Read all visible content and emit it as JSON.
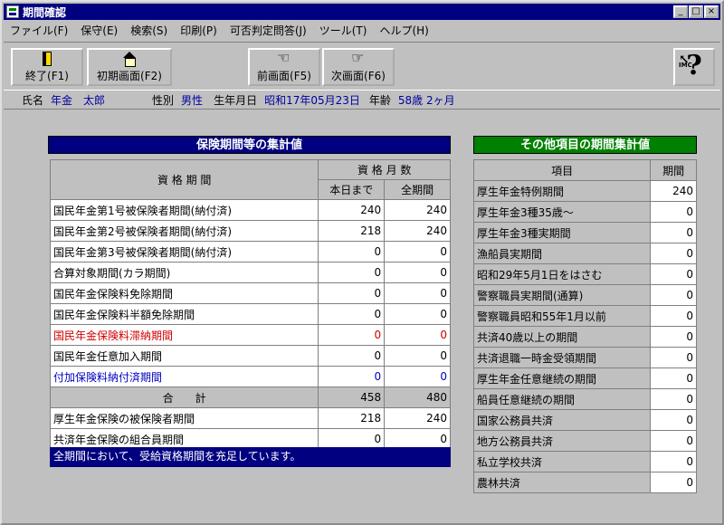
{
  "window": {
    "title": "期間確認",
    "btn_min": "_",
    "btn_max": "□",
    "btn_close": "×"
  },
  "menu": [
    "ファイル(F)",
    "保守(E)",
    "検索(S)",
    "印刷(P)",
    "可否判定問答(J)",
    "ツール(T)",
    "ヘルプ(H)"
  ],
  "toolbar": {
    "exit_label": "終了(F1)",
    "home_label": "初期画面(F2)",
    "prev_label": "前画面(F5)",
    "next_label": "次画面(F6)",
    "help_glyph": "?",
    "help_arrow": "↖",
    "help_caption": "IMC"
  },
  "person": {
    "name_label": "氏名",
    "name_value": "年金　太郎",
    "sex_label": "性別",
    "sex_value": "男性",
    "birth_label": "生年月日",
    "birth_value": "昭和17年05月23日",
    "age_label": "年齢",
    "age_value": "58歳 2ヶ月"
  },
  "left_panel": {
    "title": "保険期間等の集計値",
    "header_period": "資 格 期 間",
    "header_months": "資 格 月 数",
    "header_today": "本日まで",
    "header_all": "全期間",
    "rows": [
      {
        "label": "国民年金第1号被保険者期間(納付済)",
        "today": "240",
        "all": "240",
        "color": "normal"
      },
      {
        "label": "国民年金第2号被保険者期間(納付済)",
        "today": "218",
        "all": "240",
        "color": "normal"
      },
      {
        "label": "国民年金第3号被保険者期間(納付済)",
        "today": "0",
        "all": "0",
        "color": "normal"
      },
      {
        "label": "合算対象期間(カラ期間)",
        "today": "0",
        "all": "0",
        "color": "normal"
      },
      {
        "label": "国民年金保険料免除期間",
        "today": "0",
        "all": "0",
        "color": "normal"
      },
      {
        "label": "国民年金保険料半額免除期間",
        "today": "0",
        "all": "0",
        "color": "normal"
      },
      {
        "label": "国民年金保険料滞納期間",
        "today": "0",
        "all": "0",
        "color": "red"
      },
      {
        "label": "国民年金任意加入期間",
        "today": "0",
        "all": "0",
        "color": "normal"
      },
      {
        "label": "付加保険料納付済期間",
        "today": "0",
        "all": "0",
        "color": "blue"
      }
    ],
    "total_label": "合　　計",
    "total_today": "458",
    "total_all": "480",
    "extra_rows": [
      {
        "label": "厚生年金保険の被保険者期間",
        "today": "218",
        "all": "240"
      },
      {
        "label": "共済年金保険の組合員期間",
        "today": "0",
        "all": "0"
      }
    ],
    "message": "全期間において、受給資格期間を充足しています。"
  },
  "right_panel": {
    "title": "その他項目の期間集計値",
    "header_item": "項目",
    "header_period": "期間",
    "rows": [
      {
        "label": "厚生年金特例期間",
        "value": "240"
      },
      {
        "label": "厚生年金3種35歳～",
        "value": "0"
      },
      {
        "label": "厚生年金3種実期間",
        "value": "0"
      },
      {
        "label": "漁船員実期間",
        "value": "0"
      },
      {
        "label": "昭和29年5月1日をはさむ",
        "value": "0"
      },
      {
        "label": "警察職員実期間(通算)",
        "value": "0"
      },
      {
        "label": "警察職員昭和55年1月以前",
        "value": "0"
      },
      {
        "label": "共済40歳以上の期間",
        "value": "0"
      },
      {
        "label": "共済退職一時金受領期間",
        "value": "0"
      },
      {
        "label": "厚生年金任意継続の期間",
        "value": "0"
      },
      {
        "label": "船員任意継続の期間",
        "value": "0"
      },
      {
        "label": "国家公務員共済",
        "value": "0"
      },
      {
        "label": "地方公務員共済",
        "value": "0"
      },
      {
        "label": "私立学校共済",
        "value": "0"
      },
      {
        "label": "農林共済",
        "value": "0"
      }
    ]
  },
  "colors": {
    "title_bar": "#000080",
    "left_header": "#000080",
    "right_header": "#008000",
    "overdue": "#d00000",
    "supplementary": "#0000c0"
  }
}
